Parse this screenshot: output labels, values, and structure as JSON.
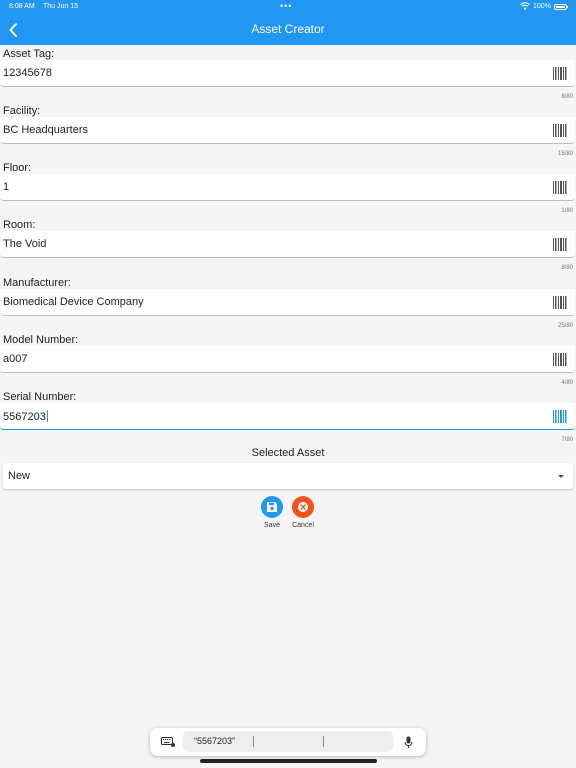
{
  "status_bar": {
    "time": "8:08 AM",
    "date": "Thu Jun 15",
    "battery": "100%"
  },
  "app_bar": {
    "title": "Asset Creator",
    "back_icon": "chevron-left-icon"
  },
  "fields": [
    {
      "label": "Asset Tag:",
      "value": "12345678",
      "counter": "8/80"
    },
    {
      "label": "Facility:",
      "value": "BC Headquarters",
      "counter": "15/80"
    },
    {
      "label": "Floor:",
      "value": "1",
      "counter": "1/80"
    },
    {
      "label": "Room:",
      "value": "The Void",
      "counter": "8/80"
    },
    {
      "label": "Manufacturer:",
      "value": "Biomedical Device Company",
      "counter": "25/80"
    },
    {
      "label": "Model Number:",
      "value": "a007",
      "counter": "4/80"
    },
    {
      "label": "Serial Number:",
      "value": "5567203",
      "counter": "7/80"
    }
  ],
  "selected_asset": {
    "label": "Selected Asset",
    "value": "New"
  },
  "actions": {
    "save_label": "Save",
    "cancel_label": "Cancel"
  },
  "keyboard_bar": {
    "suggestion": "“5567203”"
  },
  "colors": {
    "primary": "#2196f3",
    "save": "#2196f3",
    "cancel": "#f4511e"
  }
}
